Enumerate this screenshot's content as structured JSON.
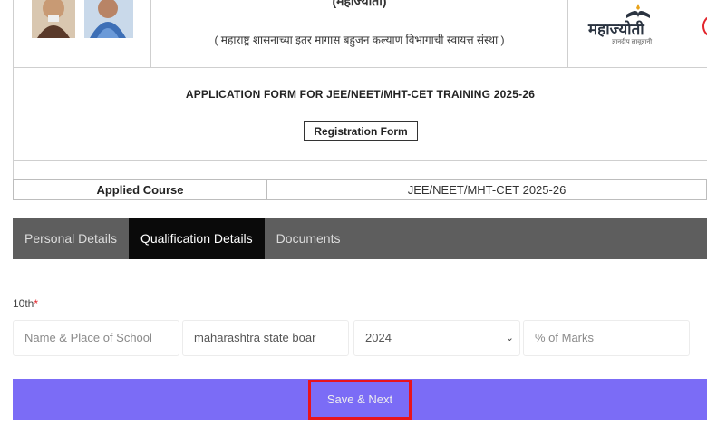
{
  "header": {
    "org_title": "(महाज्योती)",
    "org_subtitle": "( महाराष्ट्र शासनाच्या इतर मागास बहुजन कल्याण विभागाची स्वायत्त संस्था )",
    "logo_text": "महाज्योती",
    "logo_tagline": "ज्ञानदीप लावूज्ञानी",
    "colors": {
      "border": "#cfcfcf",
      "accent_red": "#e2242b"
    }
  },
  "form": {
    "title": "APPLICATION FORM FOR JEE/NEET/MHT-CET TRAINING 2025-26",
    "subtitle": "Registration Form"
  },
  "course": {
    "label": "Applied Course",
    "value": "JEE/NEET/MHT-CET 2025-26"
  },
  "tabs": [
    {
      "label": "Personal Details",
      "active": false
    },
    {
      "label": "Qualification Details",
      "active": true
    },
    {
      "label": "Documents",
      "active": false
    }
  ],
  "qualification": {
    "section_label": "10th",
    "required_mark": "*",
    "school_placeholder": "Name & Place of School",
    "board_value": "maharashtra state boar",
    "year_value": "2024",
    "marks_placeholder": "% of Marks"
  },
  "actions": {
    "save_label": "Save & Next",
    "colors": {
      "save_bg": "#7b6cf6",
      "highlight": "#e8141c"
    }
  },
  "icons": {
    "select_arrow": "chevron-down-icon",
    "logo": "book-lamp-icon"
  }
}
